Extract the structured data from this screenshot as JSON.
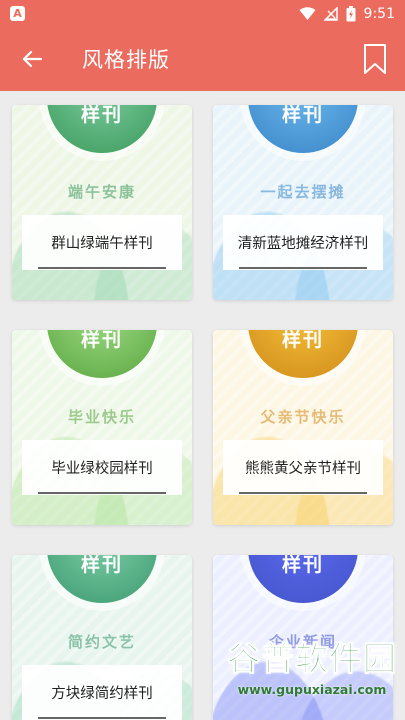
{
  "status_bar": {
    "time": "9:51",
    "app_icon_letter": "A"
  },
  "header": {
    "title": "风格排版"
  },
  "badge_text": "样刊",
  "templates": [
    {
      "name": "群山绿端午样刊",
      "subtitle": "端午安康",
      "badge_color": "#7fcca0",
      "bg": "#eef6e6",
      "accent": "#3a9a5b"
    },
    {
      "name": "清新蓝地摊经济样刊",
      "subtitle": "一起去摆摊",
      "badge_color": "#6cb8ec",
      "bg": "#e8f4fa",
      "accent": "#3a86c8"
    },
    {
      "name": "毕业绿校园样刊",
      "subtitle": "毕业快乐",
      "badge_color": "#9fdc86",
      "bg": "#eef8e8",
      "accent": "#5aa640"
    },
    {
      "name": "熊熊黄父亲节样刊",
      "subtitle": "父亲节快乐",
      "badge_color": "#f5c23a",
      "bg": "#fdf6e3",
      "accent": "#d08a1a"
    },
    {
      "name": "方块绿简约样刊",
      "subtitle": "简约文艺",
      "badge_color": "#7fcfa8",
      "bg": "#e8f5ee",
      "accent": "#3c9a70"
    },
    {
      "name": "",
      "subtitle": "企业新闻",
      "badge_color": "#5a6af0",
      "bg": "#ecefff",
      "accent": "#4454c8"
    }
  ],
  "watermark": {
    "title": "谷普软件园",
    "url": "www.gupuxiazai.com"
  }
}
